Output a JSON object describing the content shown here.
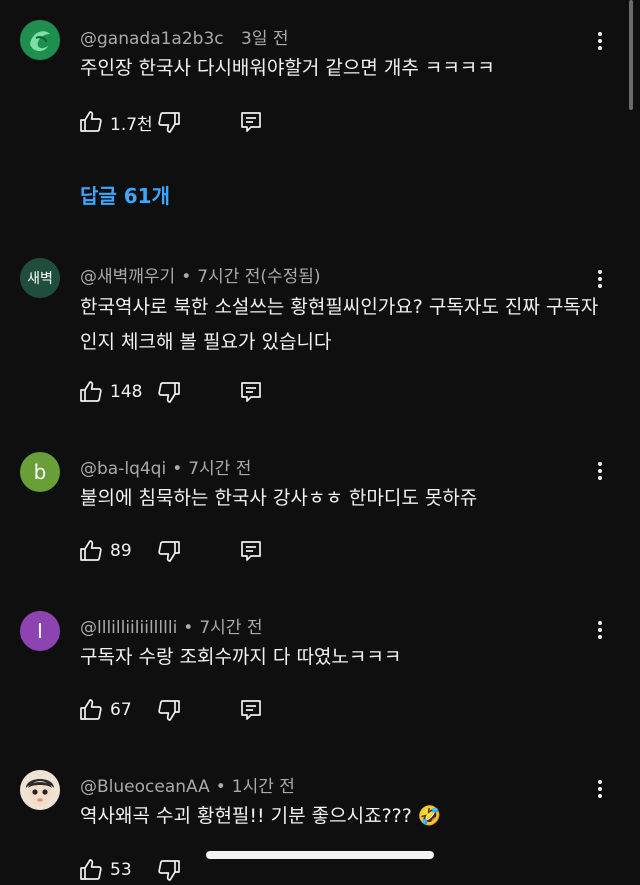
{
  "comments": [
    {
      "author": "@ganada1a2b3c",
      "time": "3일 전",
      "text": "주인장 한국사 다시배워야할거 같으면 개추 ㅋㅋㅋㅋ",
      "likes": "1.7천",
      "replies": "답글 61개",
      "avatar": {
        "label": "",
        "color": "#1e8f4e",
        "icon": "green-logo-icon"
      }
    },
    {
      "author": "@새벽깨우기",
      "time": "7시간 전(수정됨)",
      "text": "한국역사로 북한 소설쓰는  황현필씨인가요?  구독자도 진짜 구독자인지 체크해 볼 필요가 있습니다",
      "likes": "148",
      "avatar": {
        "label": "새벽",
        "color": "#1f4e3d"
      }
    },
    {
      "author": "@ba-lq4qi",
      "time": "7시간 전",
      "text": "불의에 침묵하는 한국사 강사ㅎㅎ 한마디도 못하쥬",
      "likes": "89",
      "avatar": {
        "label": "b",
        "color": "#689f38"
      }
    },
    {
      "author": "@lllilliiliillllli",
      "time": "7시간 전",
      "text": "구독자 수랑 조회수까지 다 따였노ㅋㅋㅋ",
      "likes": "67",
      "avatar": {
        "label": "I",
        "color": "#8e44b0"
      }
    },
    {
      "author": "@BlueoceanAA",
      "time": "1시간 전",
      "text": "역사왜곡 수괴 황현필!! 기분 좋으시죠??? 🤣",
      "likes": "53",
      "avatar": {
        "label": "",
        "color": "#e8d7c8",
        "icon": "baby-avatar-icon"
      }
    }
  ],
  "separator": "•",
  "icons": [
    "thumbs-up-icon",
    "thumbs-down-icon",
    "reply-icon",
    "more-vert-icon"
  ]
}
